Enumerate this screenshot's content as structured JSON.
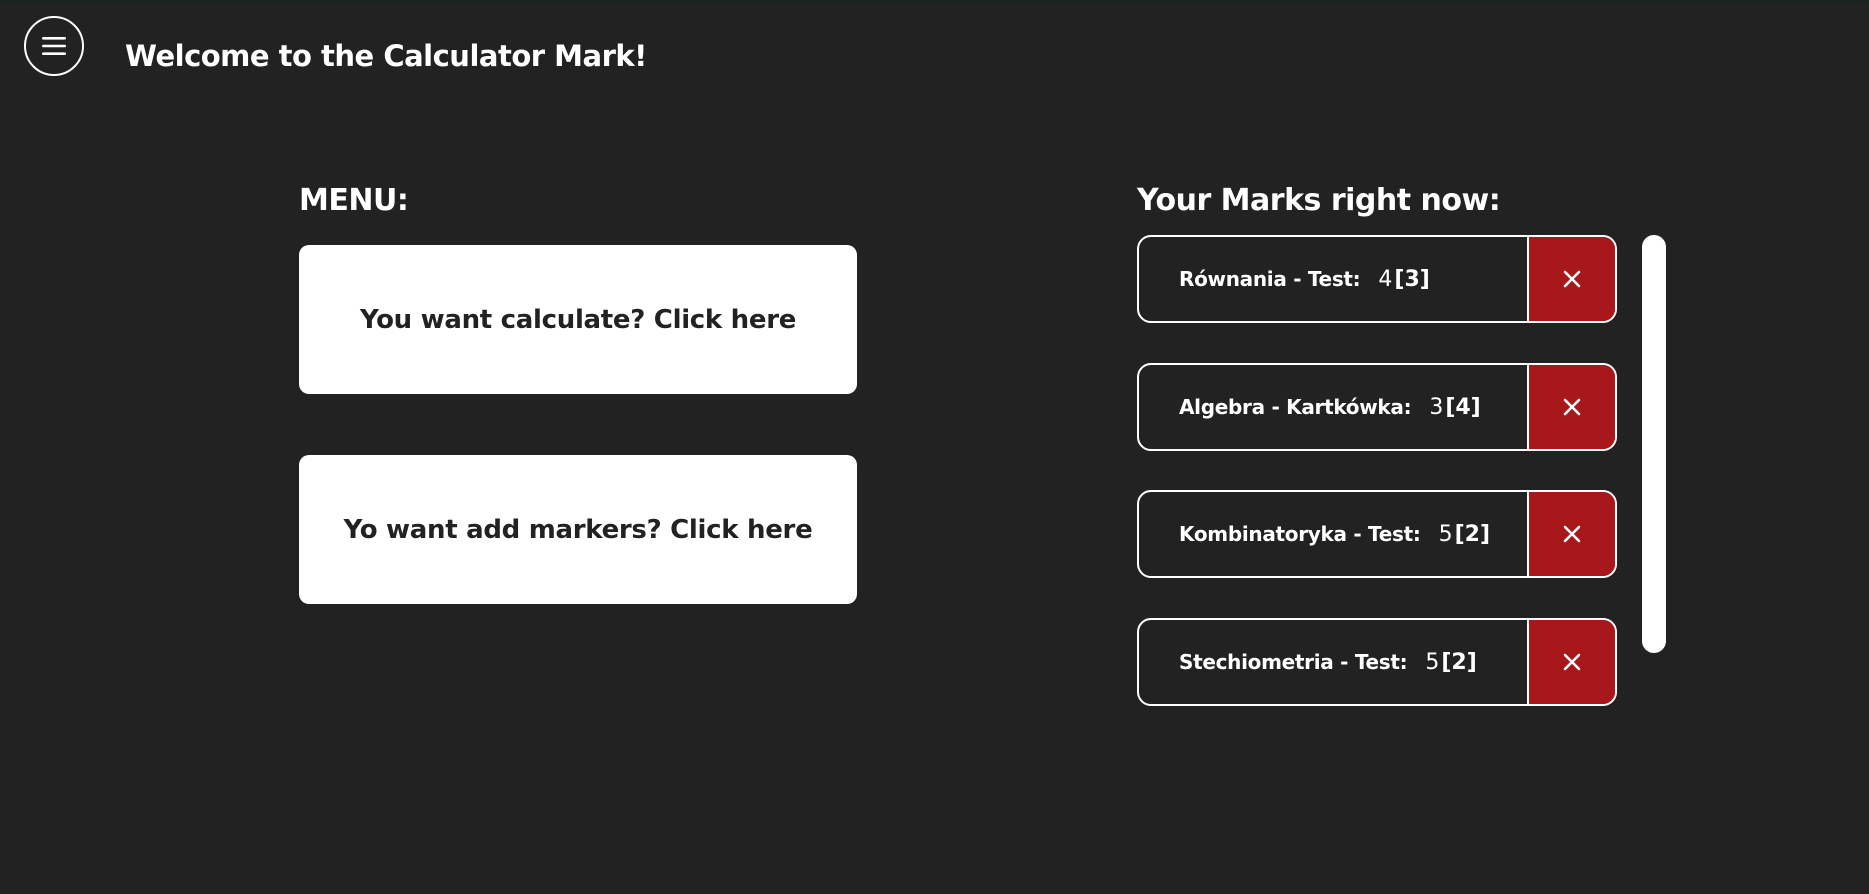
{
  "header": {
    "title": "Welcome to the Calculator Mark!",
    "menu_icon": "hamburger-menu-icon"
  },
  "menu": {
    "heading": "MENU:",
    "calculate_label": "You want calculate? Click here",
    "add_markers_label": "Yo want add markers? Click here"
  },
  "marks": {
    "heading": "Your Marks right now:",
    "delete_icon": "close-icon",
    "items": [
      {
        "name": "Równania - Test:",
        "value": "4",
        "weight": "[3]"
      },
      {
        "name": "Algebra - Kartkówka:",
        "value": "3",
        "weight": "[4]"
      },
      {
        "name": "Kombinatoryka - Test:",
        "value": "5",
        "weight": "[2]"
      },
      {
        "name": "Stechiometria - Test:",
        "value": "5",
        "weight": "[2]"
      }
    ]
  },
  "colors": {
    "background": "#222222",
    "card": "#ffffff",
    "delete": "#a8171a"
  }
}
